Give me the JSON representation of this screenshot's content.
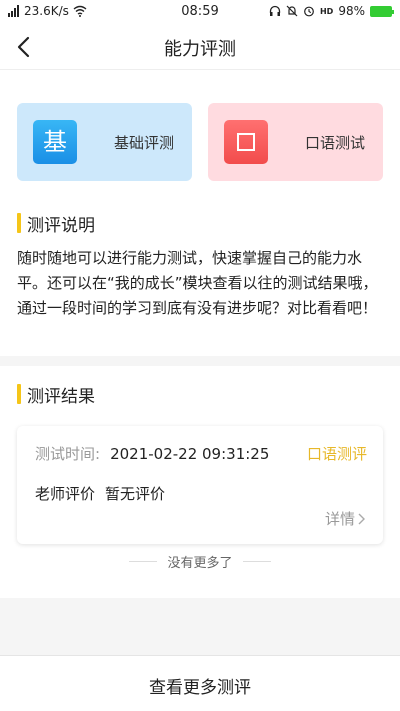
{
  "status_bar": {
    "speed": "23.6K/s",
    "time": "08:59",
    "hd_label": "HD",
    "battery": "98%"
  },
  "header": {
    "title": "能力评测"
  },
  "cards": {
    "basic": {
      "badge": "基",
      "label": "基础评测"
    },
    "oral": {
      "label": "口语测试"
    }
  },
  "description": {
    "heading": "测评说明",
    "text": "随时随地可以进行能力测试，快速掌握自己的能力水平。还可以在“我的成长”模块查看以往的测试结果哦，通过一段时间的学习到底有没有进步呢？对比看看吧！"
  },
  "results": {
    "heading": "测评结果",
    "items": [
      {
        "time_label": "测试时间:",
        "time_value": "2021-02-22 09:31:25",
        "type": "口语测评",
        "teacher_label": "老师评价",
        "teacher_value": "暂无评价",
        "detail_label": "详情"
      }
    ],
    "no_more": "没有更多了"
  },
  "footer": {
    "label": "查看更多测评"
  },
  "colors": {
    "accent_yellow": "#f5c518",
    "type_yellow": "#e7b82a",
    "card_blue_bg": "#cde8fb",
    "card_red_bg": "#ffdbe0"
  }
}
